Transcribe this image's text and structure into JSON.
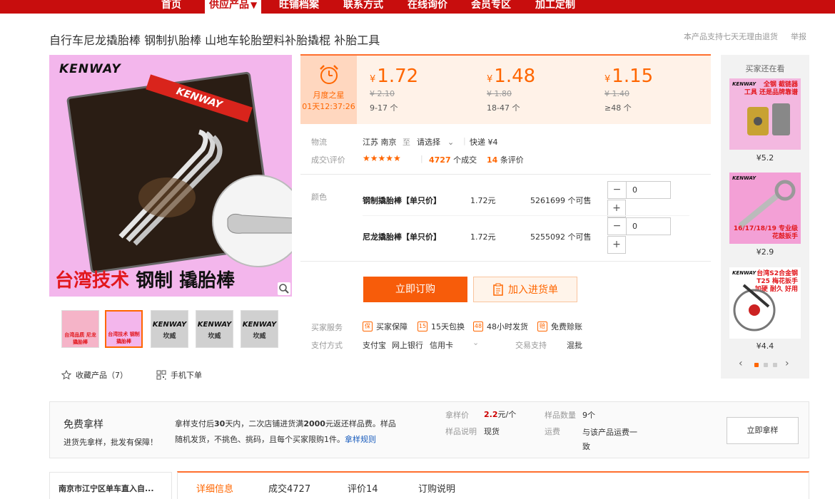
{
  "nav": {
    "items": [
      {
        "label": "首页"
      },
      {
        "label": "供应产品",
        "active": true
      },
      {
        "label": "旺铺档案"
      },
      {
        "label": "联系方式"
      },
      {
        "label": "在线询价"
      },
      {
        "label": "会员专区"
      },
      {
        "label": "加工定制"
      }
    ],
    "arrow": "▼"
  },
  "product": {
    "title": "自行车尼龙撬胎棒 钢制扒胎棒 山地车轮胎塑料补胎撬棍 补胎工具",
    "return_policy": "本产品支持七天无理由退货",
    "report": "举报",
    "image": {
      "brand": "KENWAY",
      "banner": "KENWAY",
      "slogan_red": "台湾技术",
      "slogan_black": "钢制 撬胎棒"
    },
    "thumbs": [
      {
        "caption": "台湾品质 尼龙撬胎棒"
      },
      {
        "caption": "台湾技术 钢制 撬胎棒"
      },
      {
        "brand": "KENWAY",
        "sub": "坎威"
      },
      {
        "brand": "KENWAY",
        "sub": "坎威"
      },
      {
        "brand": "KENWAY",
        "sub": "坎威"
      }
    ],
    "favorite": "收藏产品（7）",
    "mobile_order": "手机下单"
  },
  "price": {
    "promo_label": "月度之星",
    "countdown": "01天12:37:26",
    "currency": "¥",
    "tiers": [
      {
        "price": "1.72",
        "orig": "¥ 2.10",
        "qty": "9-17 个"
      },
      {
        "price": "1.48",
        "orig": "¥ 1.80",
        "qty": "18-47 个"
      },
      {
        "price": "1.15",
        "orig": "¥ 1.40",
        "qty": "≥48 个"
      }
    ]
  },
  "logistics": {
    "label": "物流",
    "from": "江苏 南京",
    "to": "至",
    "select": "请选择",
    "express": "快递 ¥4"
  },
  "deals": {
    "label": "成交\\评价",
    "rating": 4.5,
    "stars": "★★★★★",
    "count": "4727",
    "count_suffix": "个成交",
    "reviews": "14",
    "reviews_suffix": "条评价"
  },
  "color": {
    "label": "颜色",
    "rows": [
      {
        "name": "钢制撬胎棒【单只价】",
        "price": "1.72元",
        "stock": "5261699 个可售",
        "qty": "0"
      },
      {
        "name": "尼龙撬胎棒【单只价】",
        "price": "1.72元",
        "stock": "5255092 个可售",
        "qty": "0"
      }
    ]
  },
  "buttons": {
    "order": "立即订购",
    "cart": "加入进货单"
  },
  "service": {
    "label": "买家服务",
    "items": [
      {
        "icon": "保",
        "label": "买家保障"
      },
      {
        "icon": "15",
        "label": "15天包换"
      },
      {
        "icon": "48",
        "label": "48小时发货"
      },
      {
        "icon": "赔",
        "label": "免费赊账"
      }
    ]
  },
  "payment": {
    "label": "支付方式",
    "methods": [
      "支付宝",
      "网上银行",
      "信用卡"
    ],
    "trade_label": "交易支持",
    "trade_value": "混批"
  },
  "sidebar": {
    "heading": "买家还在看",
    "items": [
      {
        "tag": "全钢 截链器\n工具 还是品牌靠谱",
        "price": "¥5.2"
      },
      {
        "tag": "16/17/18/19\n专业级 花鼓扳手",
        "price": "¥2.9"
      },
      {
        "tag": "台湾S2合金钢\nT25 梅花扳手\n加硬 耐久 好用",
        "price": "¥4.4"
      }
    ]
  },
  "sample": {
    "title": "免费拿样",
    "subtitle": "进货先拿样，批发有保障！",
    "desc_pre": "拿样支付后",
    "desc_days": "30",
    "desc_mid": "天内，二次店铺进货满",
    "desc_amount": "2000",
    "desc_post": "元返还样品费。样品随机发货，不挑色、挑码，且每个买家限购1件。",
    "rule_link": "拿样规则",
    "price_label": "拿样价",
    "price_value": "2.2",
    "price_unit": "元/个",
    "qty_label": "样品数量",
    "qty_value": "9个",
    "note_label": "样品说明",
    "note_value": "现货",
    "ship_label": "运费",
    "ship_value": "与该产品运费一致",
    "button": "立即拿样"
  },
  "shop": {
    "name": "南京市江宁区单车直入自..."
  },
  "tabs": [
    {
      "label": "详细信息",
      "active": true
    },
    {
      "label": "成交4727"
    },
    {
      "label": "评价14"
    },
    {
      "label": "订购说明"
    }
  ]
}
